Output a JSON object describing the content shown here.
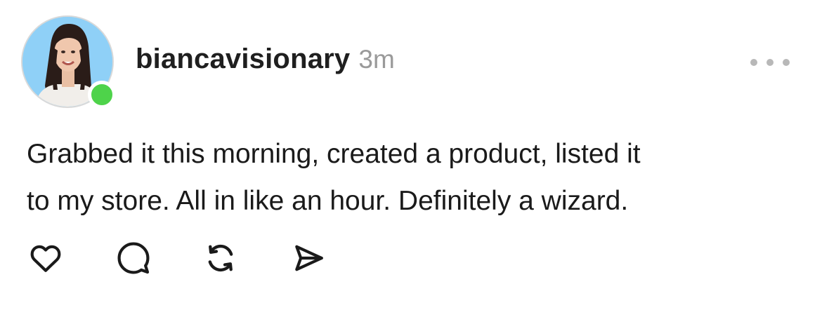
{
  "post": {
    "username": "biancavisionary",
    "time": "3m",
    "body_lines": [
      "Grabbed it this morning, created a product, listed it",
      "to my store. All in like an hour. Definitely a wizard."
    ],
    "online_status_color": "#4ed34a"
  },
  "icons": {
    "more": "more-horizontal-icon",
    "like": "heart-icon",
    "reply": "comment-bubble-icon",
    "repost": "repost-arrows-icon",
    "share": "send-paper-plane-icon"
  }
}
